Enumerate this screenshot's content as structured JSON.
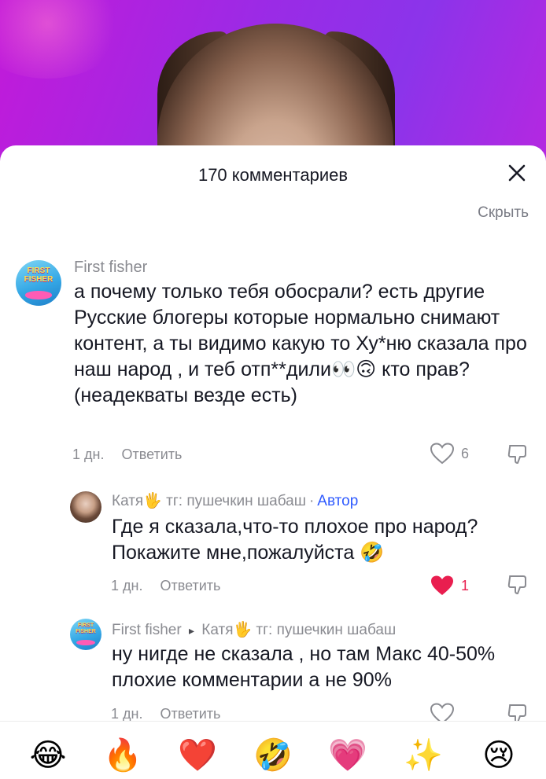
{
  "sheet": {
    "title": "170 комментариев",
    "hide": "Скрыть"
  },
  "comments": [
    {
      "author": "First fisher",
      "avatar_text": "FIRST FISHER",
      "text": "а почему только тебя обосрали? есть другие Русские блогеры которые нормально снимают контент, а ты видимо какую то Ху*ню сказала про наш народ , и теб отп**дили👀🙃 кто прав?(неадекваты везде есть)",
      "time": "1 дн.",
      "reply": "Ответить",
      "likes": "6",
      "liked": false
    },
    {
      "author": "Катя🖐 тг: пушечкин шабаш",
      "author_separator": "·",
      "author_tag": "Автор",
      "text": "Где я сказала,что-то плохое про народ? Покажите мне,пожалуйста 🤣",
      "time": "1 дн.",
      "reply": "Ответить",
      "likes": "1",
      "liked": true
    },
    {
      "author": "First fisher",
      "reply_arrow": "▸",
      "reply_to": "Катя🖐 тг: пушечкин шабаш",
      "avatar_text": "FIRST FISHER",
      "text": "ну нигде не сказала , но там Макс 40-50% плохие комментарии а не 90%",
      "time": "1 дн.",
      "reply": "Ответить",
      "liked": false
    }
  ],
  "emoji_bar": [
    "😂",
    "🔥",
    "❤️",
    "🤣",
    "💗",
    "✨",
    "😢"
  ],
  "colors": {
    "accent_blue": "#2f5bff",
    "like_red": "#e91e4f",
    "muted": "#8a8b91",
    "text": "#161823"
  }
}
